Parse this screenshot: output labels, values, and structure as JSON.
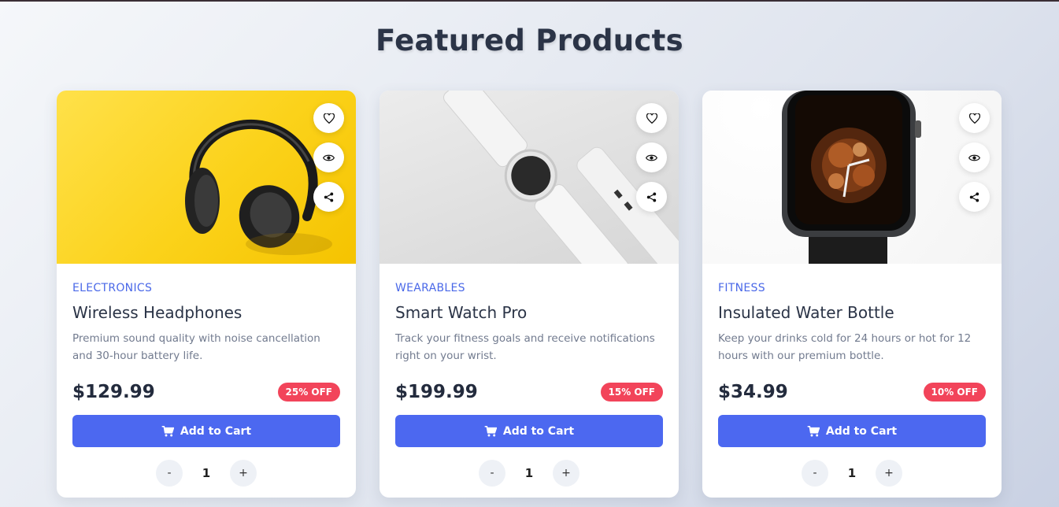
{
  "page": {
    "title": "Featured Products"
  },
  "colors": {
    "accent": "#4c68f0",
    "badge": "#f2445a",
    "category": "#4a68e8"
  },
  "products": [
    {
      "category": "ELECTRONICS",
      "name": "Wireless Headphones",
      "description": "Premium sound quality with noise cancellation and 30-hour battery life.",
      "price": "$129.99",
      "discount": "25% OFF",
      "cart_label": "Add to Cart",
      "quantity": "1",
      "image": "headphones-image"
    },
    {
      "category": "WEARABLES",
      "name": "Smart Watch Pro",
      "description": "Track your fitness goals and receive notifications right on your wrist.",
      "price": "$199.99",
      "discount": "15% OFF",
      "cart_label": "Add to Cart",
      "quantity": "1",
      "image": "smart-watch-image"
    },
    {
      "category": "FITNESS",
      "name": "Insulated Water Bottle",
      "description": "Keep your drinks cold for 24 hours or hot for 12 hours with our premium bottle.",
      "price": "$34.99",
      "discount": "10% OFF",
      "cart_label": "Add to Cart",
      "quantity": "1",
      "image": "apple-watch-image"
    }
  ],
  "qty_controls": {
    "minus": "-",
    "plus": "+"
  },
  "icons": [
    "heart-icon",
    "eye-icon",
    "share-icon",
    "cart-icon"
  ]
}
